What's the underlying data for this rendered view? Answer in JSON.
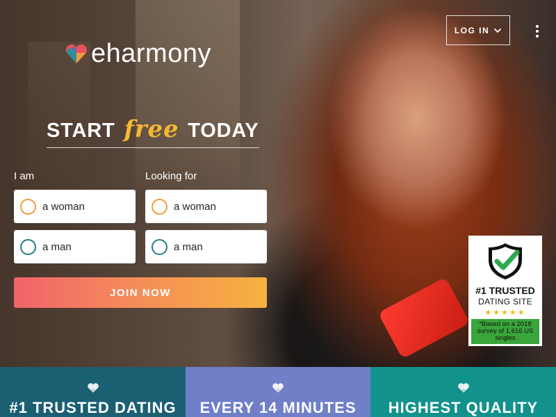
{
  "brand": {
    "name": "eharmony"
  },
  "header": {
    "login_label": "LOG IN"
  },
  "headline": {
    "before": "START",
    "emphasis": "free",
    "after": "TODAY"
  },
  "form": {
    "i_am_label": "I am",
    "looking_for_label": "Looking for",
    "i_am_options": [
      "a woman",
      "a man"
    ],
    "looking_for_options": [
      "a woman",
      "a man"
    ],
    "join_label": "JOIN NOW"
  },
  "badge": {
    "title": "#1 TRUSTED",
    "subtitle": "DATING SITE",
    "stars": "★★★★★",
    "note": "*Based on a 2018 survey of 1,616 US singles"
  },
  "tiles": [
    {
      "text": "#1 TRUSTED DATING",
      "color": "#1b5f73"
    },
    {
      "text": "EVERY 14 MINUTES",
      "color": "#6f7fc8"
    },
    {
      "text": "HIGHEST QUALITY",
      "color": "#13918c"
    }
  ],
  "colors": {
    "accent_orange": "#f29b3a",
    "accent_teal": "#1e7f86",
    "free_yellow": "#f7b733",
    "join_gradient_start": "#f1636b",
    "join_gradient_end": "#f7b23f",
    "badge_green": "#3aa53a"
  },
  "icons": [
    "heart-logo-icon",
    "chevron-down-icon",
    "kebab-menu-icon",
    "shield-check-icon",
    "heart-icon"
  ]
}
